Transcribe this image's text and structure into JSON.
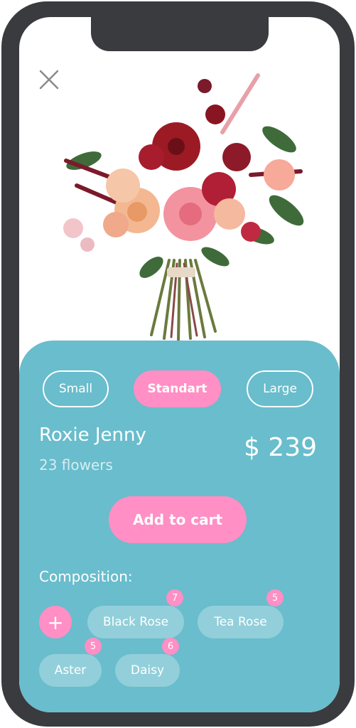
{
  "product": {
    "name": "Roxie Jenny",
    "flower_count": "23 flowers",
    "price": "$ 239"
  },
  "sizes": {
    "small": "Small",
    "standard": "Standart",
    "large": "Large",
    "selected": "Standart"
  },
  "actions": {
    "add_to_cart": "Add to cart",
    "add_composition": "+"
  },
  "composition": {
    "title": "Composition:",
    "items": [
      {
        "name": "Black Rose",
        "count": "7"
      },
      {
        "name": "Tea Rose",
        "count": "5"
      },
      {
        "name": "Aster",
        "count": "5"
      },
      {
        "name": "Daisy",
        "count": "6"
      }
    ]
  },
  "icons": {
    "close": "close-icon",
    "add": "plus-icon"
  },
  "colors": {
    "accent_pink": "#ff8fc4",
    "panel_teal": "#69bdcc",
    "phone_frame": "#3a3b3f"
  }
}
